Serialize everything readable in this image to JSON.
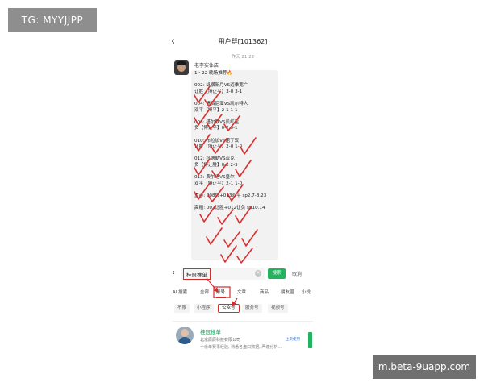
{
  "badges": {
    "tg": "TG: MYYJJPP",
    "watermark": "m.beta-9uapp.com"
  },
  "chat": {
    "title": "用户群[101362]",
    "timestamp": "昨天 21:22",
    "sender": "老李实体店",
    "lines": [
      "1・22 晚场推荐🔥",
      "",
      "002: 纵横新月VS迈季宽广",
      "让胜【博让平】3-0 3-1",
      "",
      "004: 情侣尼亚VS凯尔特人",
      "双平【博平】2-1 1-1",
      "",
      "008: 塔尔默VS贝红星",
      "负【博让平】0-2 0-1",
      "",
      "010: 布拉加VS诺丁汉",
      "让胜【博让平】2-0 1-0",
      "",
      "012: 科德勒VS亚克",
      "负【博让胜】0-2 2-3",
      "",
      "013: 费尔塔VS皇尔",
      "双平【博让平】2-1 1-0",
      "",
      "重心: 008负+013双平 sp2.7-3.23",
      "",
      "高赔: 002让胜+012让负 sp10.14"
    ]
  },
  "search": {
    "query": "桂冠推单",
    "search_button": "搜索",
    "cancel": "取消",
    "tabs": [
      "AI 搜索",
      "全部",
      "账号",
      "文章",
      "商品",
      "朋友圈",
      "小说"
    ],
    "active_tab": "账号",
    "chips": [
      "不限",
      "小程序",
      "公众号",
      "服务号",
      "视频号"
    ],
    "active_chip": "公众号"
  },
  "result": {
    "name": "桂冠推单",
    "company": "北京辰辰科技有限公司",
    "description": "十余年赛事经验, 熟悉各盘口数据, 严谨分析…",
    "tag": "上次使用"
  },
  "colors": {
    "accent": "#d42b2b",
    "green": "#22b35e"
  }
}
